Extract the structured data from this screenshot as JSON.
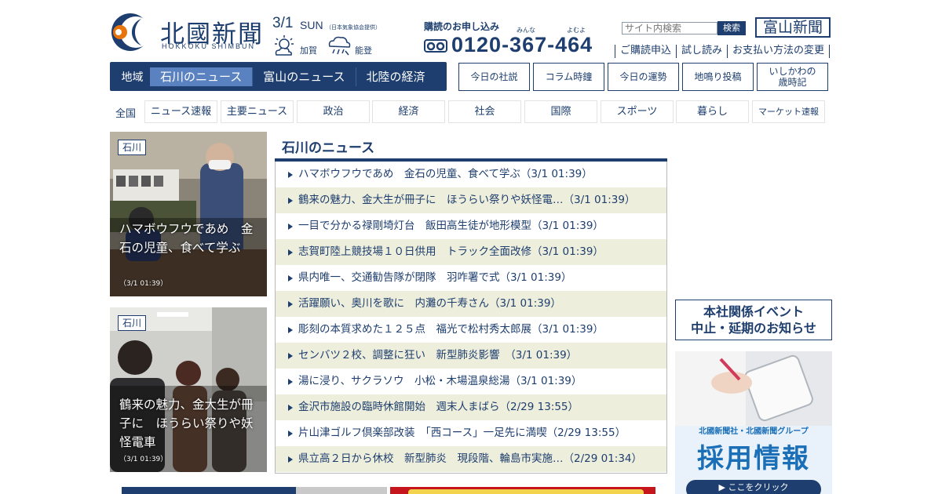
{
  "header": {
    "logo_text": "北國新聞",
    "logo_subtext": "HOKKOKU SHIMBUN",
    "date": "3/1",
    "day_of_week": "SUN",
    "weather_source": "（日本気象協会提供）",
    "weather": [
      {
        "area": "加賀",
        "icon": "sun-cloud-icon"
      },
      {
        "area": "能登",
        "icon": "rain-cloud-icon"
      }
    ],
    "subscribe_title": "購読のお申し込み",
    "phone_reading": [
      "みんな",
      "よむよ"
    ],
    "phone": "0120-367-464",
    "search_placeholder": "サイト内検索",
    "search_button": "検索",
    "toyama_link": "富山新聞",
    "util_links": [
      "ご購読申込",
      "試し読み",
      "お支払い方法の変更"
    ]
  },
  "region_nav": {
    "lead": "地域",
    "tabs": [
      "石川のニュース",
      "富山のニュース",
      "北陸の経済"
    ],
    "active_index": 0
  },
  "square_buttons": [
    {
      "label": "今日の社説"
    },
    {
      "label": "コラム時鐘"
    },
    {
      "label": "今日の運勢"
    },
    {
      "label": "地鳴り投稿"
    },
    {
      "label": "いしかわの\n歳時記"
    }
  ],
  "category_nav": {
    "lead": "全国",
    "items": [
      "ニュース速報",
      "主要ニュース",
      "政治",
      "経済",
      "社会",
      "国際",
      "スポーツ",
      "暮らし",
      "マーケット速報"
    ]
  },
  "photo_cards": [
    {
      "tag": "石川",
      "caption": "ハマボウフウであめ　金石の児童、食べて学ぶ",
      "time": "（3/1 01:39）"
    },
    {
      "tag": "石川",
      "caption": "鶴来の魅力、金大生が冊子に　ほうらい祭りや妖怪電車",
      "time": "（3/1 01:39）"
    }
  ],
  "news": {
    "title": "石川のニュース",
    "items": [
      "ハマボウフウであめ　金石の児童、食べて学ぶ（3/1 01:39）",
      "鶴来の魅力、金大生が冊子に　ほうらい祭りや妖怪電…（3/1 01:39）",
      "一目で分かる禄剛埼灯台　飯田高生徒が地形模型（3/1 01:39）",
      "志賀町陸上競技場１０日供用　トラック全面改修（3/1 01:39）",
      "県内唯一、交通勧告隊が閉隊　羽咋署で式（3/1 01:39）",
      "活躍願い、奥川を歌に　内灘の千寿さん（3/1 01:39）",
      "彫刻の本質求めた１２５点　福光で松村秀太郎展（3/1 01:39）",
      "センバツ２校、調整に狂い　新型肺炎影響　（3/1 01:39）",
      "湯に浸り、サクラソウ　小松・木場温泉総湯（3/1 01:39）",
      "金沢市施設の臨時休館開始　週末人まばら（2/29 13:55）",
      "片山津ゴルフ倶楽部改装　「西コース」一足先に満喫（2/29 13:55）",
      "県立高２日から休校　新型肺炎　現段階、輪島市実施…（2/29 01:34）"
    ]
  },
  "event_banner": {
    "line1": "本社関係イベント",
    "line2": "中止・延期のお知らせ"
  },
  "recruit_banner": {
    "group": "北國新聞社・北國新聞グループ",
    "title": "採用情報",
    "button": "▶ ここをクリック"
  },
  "colors": {
    "navy": "#1d3e6e",
    "active_tab": "#5b82c0",
    "row_alt": "#eeeedd",
    "recruit_blue": "#1a6fb7"
  }
}
